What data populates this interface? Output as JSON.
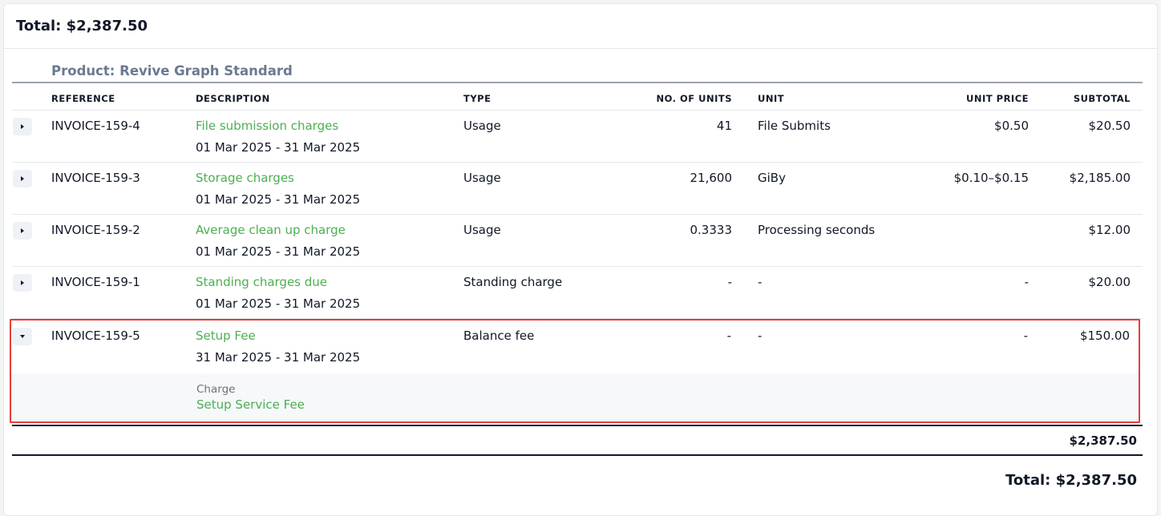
{
  "header": {
    "total": "Total: $2,387.50"
  },
  "product": {
    "title": "Product: Revive Graph Standard"
  },
  "columns": {
    "reference": "REFERENCE",
    "description": "DESCRIPTION",
    "type": "TYPE",
    "units": "NO. OF UNITS",
    "unit": "UNIT",
    "unit_price": "UNIT PRICE",
    "subtotal": "SUBTOTAL"
  },
  "rows": [
    {
      "reference": "INVOICE-159-4",
      "description": "File submission charges",
      "period": "01 Mar 2025 - 31 Mar 2025",
      "type": "Usage",
      "units": "41",
      "unit": "File Submits",
      "unit_price": "$0.50",
      "subtotal": "$20.50",
      "expanded": false
    },
    {
      "reference": "INVOICE-159-3",
      "description": "Storage charges",
      "period": "01 Mar 2025 - 31 Mar 2025",
      "type": "Usage",
      "units": "21,600",
      "unit": "GiBy",
      "unit_price": "$0.10–$0.15",
      "subtotal": "$2,185.00",
      "expanded": false
    },
    {
      "reference": "INVOICE-159-2",
      "description": "Average clean up charge",
      "period": "01 Mar 2025 - 31 Mar 2025",
      "type": "Usage",
      "units": "0.3333",
      "unit": "Processing seconds",
      "unit_price": "",
      "subtotal": "$12.00",
      "expanded": false
    },
    {
      "reference": "INVOICE-159-1",
      "description": "Standing charges due",
      "period": "01 Mar 2025 - 31 Mar 2025",
      "type": "Standing charge",
      "units": "-",
      "unit": "-",
      "unit_price": "-",
      "subtotal": "$20.00",
      "expanded": false
    },
    {
      "reference": "INVOICE-159-5",
      "description": "Setup Fee",
      "period": "31 Mar 2025 - 31 Mar 2025",
      "type": "Balance fee",
      "units": "-",
      "unit": "-",
      "unit_price": "-",
      "subtotal": "$150.00",
      "expanded": true
    }
  ],
  "expanded_detail": {
    "label": "Charge",
    "value": "Setup Service Fee"
  },
  "section_subtotal": "$2,387.50",
  "footer": {
    "total": "Total: $2,387.50"
  },
  "colors": {
    "accent_green": "#4caf50",
    "highlight_border": "#e53e3e"
  }
}
